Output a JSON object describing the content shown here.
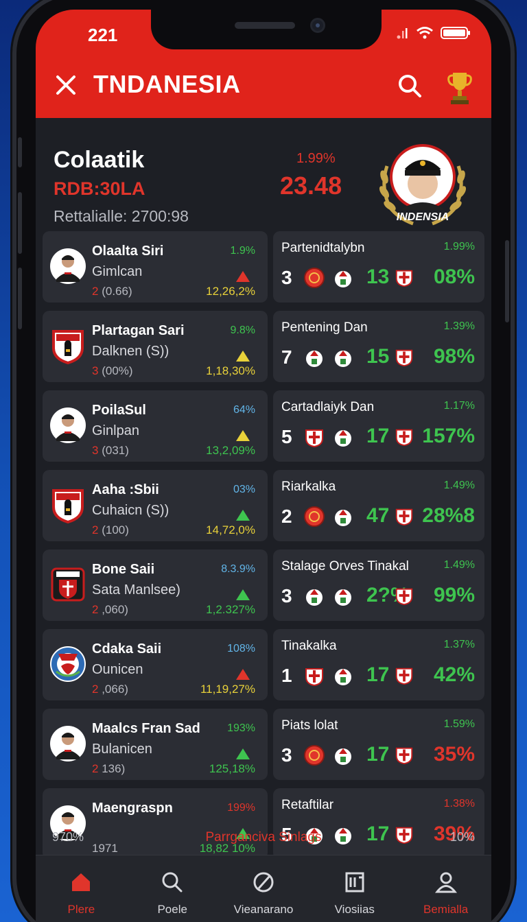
{
  "status_bar": {
    "time": "221"
  },
  "header": {
    "title": "TNDANESIA"
  },
  "hero": {
    "name": "Colaatik",
    "code": "RDB:30LA",
    "subtitle": "Rettalialle: 2700:98",
    "change_pct": "1.99%",
    "value": "23.48",
    "badge_label": "INDENSIA"
  },
  "rows": [
    {
      "player": {
        "name": "Olaalta Siri",
        "sub": "Gimlcan",
        "extra_num": "2",
        "extra_rest": "(0.66)",
        "pct": "1.9%",
        "pct_color": "#3ec44f",
        "arrow": "up",
        "arrow_color": "#e0352b",
        "vol": "12,26,2%",
        "vol_color": "#e8d13a",
        "avatar": "person"
      },
      "match": {
        "name": "Partenidtalybn",
        "pct": "1.99%",
        "pct_color": "#3ec44f",
        "left": "3",
        "right": "13",
        "big": "08%",
        "big_color": "#3ec44f"
      }
    },
    {
      "player": {
        "name": "Plartagan Sari",
        "sub": "Dalknen (S))",
        "extra_num": "3",
        "extra_rest": "(00%)",
        "pct": "9.8%",
        "pct_color": "#3ec44f",
        "arrow": "up",
        "arrow_color": "#e8d13a",
        "vol": "1,18,30%",
        "vol_color": "#e8d13a",
        "avatar": "shield"
      },
      "match": {
        "name": "Pentening Dan",
        "pct": "1.39%",
        "pct_color": "#3ec44f",
        "left": "7",
        "right": "15",
        "big": "98%",
        "big_color": "#3ec44f"
      }
    },
    {
      "player": {
        "name": "PoilaSul",
        "sub": "Ginlpan",
        "extra_num": "3",
        "extra_rest": "(031)",
        "pct": "64%",
        "pct_color": "#62b5e8",
        "arrow": "up",
        "arrow_color": "#e8d13a",
        "vol": "13,2,09%",
        "vol_color": "#3ec44f",
        "avatar": "person"
      },
      "match": {
        "name": "Cartadlaiyk Dan",
        "pct": "1.17%",
        "pct_color": "#3ec44f",
        "left": "5",
        "right": "17",
        "big": "157%",
        "big_color": "#3ec44f"
      }
    },
    {
      "player": {
        "name": "Aaha :Sbii",
        "sub": "Cuhaicn (S))",
        "extra_num": "2",
        "extra_rest": "(100)",
        "pct": "03%",
        "pct_color": "#62b5e8",
        "arrow": "up",
        "arrow_color": "#3ec44f",
        "vol": "14,72,0%",
        "vol_color": "#e8d13a",
        "avatar": "shield"
      },
      "match": {
        "name": "Riarkalka",
        "pct": "1.49%",
        "pct_color": "#3ec44f",
        "left": "2",
        "right": "47",
        "big": "28%8",
        "big_color": "#3ec44f"
      }
    },
    {
      "player": {
        "name": "Bone Saii",
        "sub": "Sata Manlsee)",
        "extra_num": "2",
        "extra_rest": ",060)",
        "pct": "8.3.9%",
        "pct_color": "#62b5e8",
        "arrow": "up",
        "arrow_color": "#3ec44f",
        "vol": "1,2.327%",
        "vol_color": "#3ec44f",
        "avatar": "crest"
      },
      "match": {
        "name": "Stalage Orves Tinakal",
        "pct": "1.49%",
        "pct_color": "#3ec44f",
        "left": "3",
        "right": "2?%",
        "big": "99%",
        "big_color": "#3ec44f"
      }
    },
    {
      "player": {
        "name": "Cdaka Saii",
        "sub": "Ounicen",
        "extra_num": "2",
        "extra_rest": ",066)",
        "pct": "108%",
        "pct_color": "#62b5e8",
        "arrow": "up",
        "arrow_color": "#e0352b",
        "vol": "11,19,27%",
        "vol_color": "#e8d13a",
        "avatar": "roundcrest"
      },
      "match": {
        "name": "Tinakalka",
        "pct": "1.37%",
        "pct_color": "#3ec44f",
        "left": "1",
        "right": "17",
        "big": "42%",
        "big_color": "#3ec44f"
      }
    },
    {
      "player": {
        "name": "Maalcs Fran Sad",
        "sub": "Bulanicen",
        "extra_num": "2",
        "extra_rest": "136)",
        "pct": "193%",
        "pct_color": "#3ec44f",
        "arrow": "up",
        "arrow_color": "#3ec44f",
        "vol": "125,18%",
        "vol_color": "#3ec44f",
        "avatar": "person"
      },
      "match": {
        "name": "Piats lolat",
        "pct": "1.59%",
        "pct_color": "#3ec44f",
        "left": "3",
        "right": "17",
        "big": "35%",
        "big_color": "#e0352b"
      }
    },
    {
      "player": {
        "name": "Maengraspn",
        "sub": "",
        "extra_num": "",
        "extra_rest": "1971",
        "pct": "199%",
        "pct_color": "#e0352b",
        "arrow": "up",
        "arrow_color": "#3ec44f",
        "vol": "18,82 10%",
        "vol_color": "#3ec44f",
        "avatar": "person"
      },
      "match": {
        "name": "Retaftilar",
        "pct": "1.38%",
        "pct_color": "#e0352b",
        "left": "5",
        "right": "17",
        "big": "39%",
        "big_color": "#e0352b"
      }
    }
  ],
  "footer": {
    "left": "970%",
    "center": "Parrganciva Sinlags",
    "right": "10%"
  },
  "nav": [
    {
      "label": "Plere",
      "icon": "home-icon",
      "active": true
    },
    {
      "label": "Poele",
      "icon": "search-icon",
      "active": false
    },
    {
      "label": "Vieanarano",
      "icon": "compass-icon",
      "active": false
    },
    {
      "label": "Viosiias",
      "icon": "news-icon",
      "active": false
    },
    {
      "label": "Bemialla",
      "icon": "profile-icon",
      "active": true
    }
  ],
  "colors": {
    "accent": "#e0231b",
    "green": "#3ec44f",
    "yellow": "#e8d13a",
    "panel": "#2b2d34"
  }
}
